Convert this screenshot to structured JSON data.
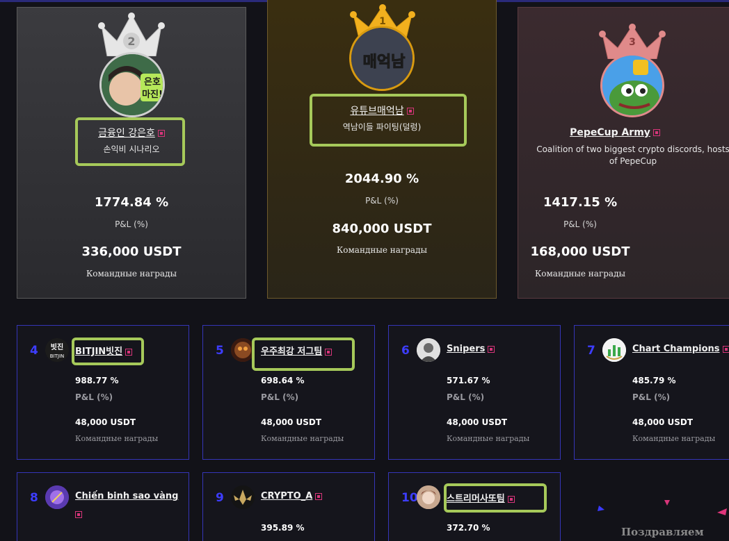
{
  "podium": [
    {
      "rank": "2",
      "name": "금융인 강은호",
      "desc": "손익비 시나리오",
      "pct": "1774.84 %",
      "pl_label": "P&L (%)",
      "reward": "336,000 USDT",
      "reward_label": "Командные награды",
      "avatar_text": "은호\n마진!"
    },
    {
      "rank": "1",
      "name": "유튜브매억남",
      "desc": "역남이들 파이팅(덜렁)",
      "pct": "2044.90 %",
      "pl_label": "P&L (%)",
      "reward": "840,000 USDT",
      "reward_label": "Командные награды",
      "avatar_text": "매억남"
    },
    {
      "rank": "3",
      "name": "PepeCup Army",
      "desc": "Coalition of two biggest crypto discords, hosts of PepeCup",
      "pct": "1417.15 %",
      "pl_label": "P&L (%)",
      "reward": "168,000 USDT",
      "reward_label": "Командные награды"
    }
  ],
  "cards": [
    {
      "rank": "4",
      "name": "BITJIN빗진",
      "pct": "988.77 %",
      "pl_label": "P&L (%)",
      "reward": "48,000 USDT",
      "reward_label": "Командные награды",
      "avatar_text": "빗진"
    },
    {
      "rank": "5",
      "name": "우주최강 저그팀",
      "pct": "698.64 %",
      "pl_label": "P&L (%)",
      "reward": "48,000 USDT",
      "reward_label": "Командные награды"
    },
    {
      "rank": "6",
      "name": "Snipers",
      "pct": "571.67 %",
      "pl_label": "P&L (%)",
      "reward": "48,000 USDT",
      "reward_label": "Командные награды"
    },
    {
      "rank": "7",
      "name": "Chart Champions",
      "pct": "485.79 %",
      "pl_label": "P&L (%)",
      "reward": "48,000 USDT",
      "reward_label": "Командные награды"
    },
    {
      "rank": "8",
      "name": "Chiến binh sao vàng"
    },
    {
      "rank": "9",
      "name": "CRYPTO_A",
      "pct": "395.89 %"
    },
    {
      "rank": "10",
      "name": "스트리머사또팀",
      "pct": "372.70 %"
    }
  ],
  "congrats": "Поздравляем",
  "colors": {
    "highlight": "#a6c95a",
    "rank_blue": "#3d3dff",
    "card_border": "#3535b8",
    "link_icon": "#d8357a"
  }
}
